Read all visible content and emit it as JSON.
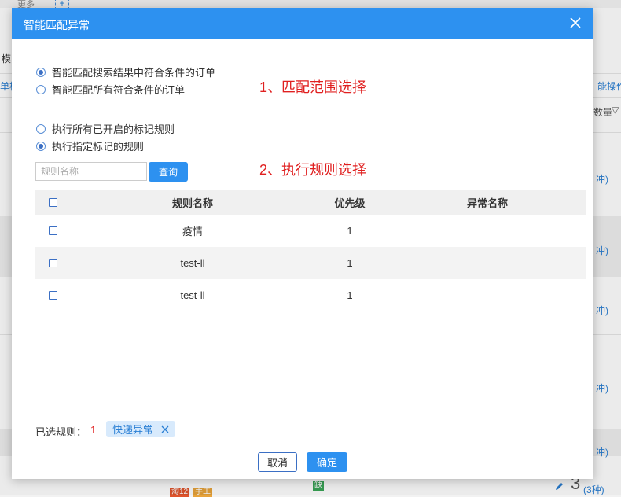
{
  "background": {
    "more_label": "更多",
    "plus_label": "+",
    "mo_label": "模",
    "left_link": "单核",
    "right_link": "能操作",
    "qty_label": "数量",
    "count_labels": [
      "冲)",
      "冲)",
      "冲)",
      "冲)",
      "冲)"
    ],
    "tag_tao": "淘12",
    "tag_manual": "手工",
    "tag_que": "缺",
    "big_number": "3",
    "bottom_count": "(3种)"
  },
  "dialog": {
    "title": "智能匹配异常",
    "scope_options": [
      {
        "label": "智能匹配搜索结果中符合条件的订单",
        "checked": true
      },
      {
        "label": "智能匹配所有符合条件的订单",
        "checked": false
      }
    ],
    "scope_annotation": "1、匹配范围选择",
    "rule_options": [
      {
        "label": "执行所有已开启的标记规则",
        "checked": false
      },
      {
        "label": "执行指定标记的规则",
        "checked": true
      }
    ],
    "rule_annotation": "2、执行规则选择",
    "search": {
      "placeholder": "规则名称",
      "value": "",
      "button_label": "查询"
    },
    "table": {
      "headers": [
        "规则名称",
        "优先级",
        "异常名称"
      ],
      "rows": [
        {
          "name": "疫情",
          "priority": "1",
          "abnormal": ""
        },
        {
          "name": "test-ll",
          "priority": "1",
          "abnormal": ""
        },
        {
          "name": "test-ll",
          "priority": "1",
          "abnormal": ""
        }
      ]
    },
    "selected": {
      "label": "已选规则：",
      "count": "1",
      "tag": "快递异常"
    },
    "cancel_label": "取消",
    "ok_label": "确定"
  },
  "colors": {
    "primary": "#2d91f0",
    "annotation": "#e02020",
    "tag_bg": "#d8eafc"
  }
}
